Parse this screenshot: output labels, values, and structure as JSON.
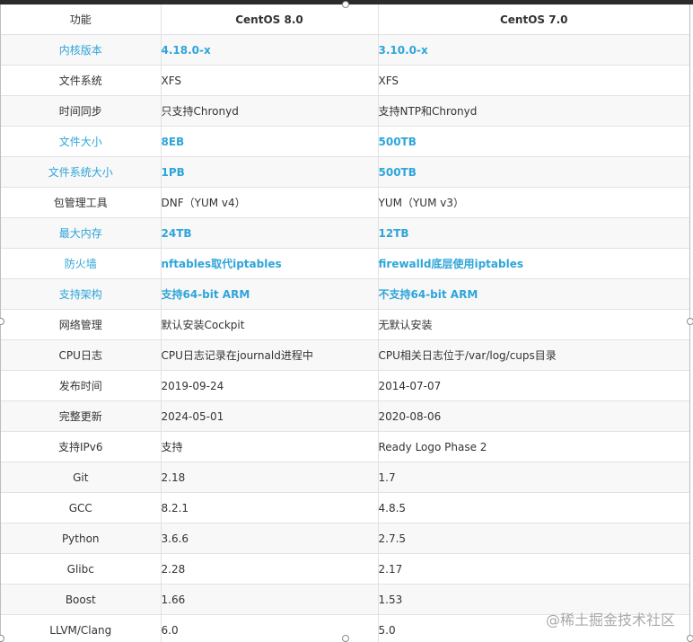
{
  "table": {
    "headers": [
      "功能",
      "CentOS 8.0",
      "CentOS 7.0"
    ],
    "rows": [
      {
        "feature": "内核版本",
        "centos8": "4.18.0-x",
        "centos7": "3.10.0-x",
        "highlight": true
      },
      {
        "feature": "文件系统",
        "centos8": "XFS",
        "centos7": "XFS",
        "highlight": false
      },
      {
        "feature": "时间同步",
        "centos8": "只支持Chronyd",
        "centos7": "支持NTP和Chronyd",
        "highlight": false
      },
      {
        "feature": "文件大小",
        "centos8": "8EB",
        "centos7": "500TB",
        "highlight": true
      },
      {
        "feature": "文件系统大小",
        "centos8": "1PB",
        "centos7": "500TB",
        "highlight": true
      },
      {
        "feature": "包管理工具",
        "centos8": "DNF（YUM v4）",
        "centos7": "YUM（YUM v3）",
        "highlight": false
      },
      {
        "feature": "最大内存",
        "centos8": "24TB",
        "centos7": "12TB",
        "highlight": true
      },
      {
        "feature": "防火墙",
        "centos8": "nftables取代iptables",
        "centos7": "firewalld底层使用iptables",
        "highlight": true
      },
      {
        "feature": "支持架构",
        "centos8": "支持64-bit ARM",
        "centos7": "不支持64-bit ARM",
        "highlight": true
      },
      {
        "feature": "网络管理",
        "centos8": "默认安装Cockpit",
        "centos7": "无默认安装",
        "highlight": false
      },
      {
        "feature": "CPU日志",
        "centos8": "CPU日志记录在journald进程中",
        "centos7": "CPU相关日志位于/var/log/cups目录",
        "highlight": false
      },
      {
        "feature": "发布时间",
        "centos8": "2019-09-24",
        "centos7": "2014-07-07",
        "highlight": false
      },
      {
        "feature": "完整更新",
        "centos8": "2024-05-01",
        "centos7": "2020-08-06",
        "highlight": false
      },
      {
        "feature": "支持IPv6",
        "centos8": "支持",
        "centos7": "Ready Logo Phase 2",
        "highlight": false
      },
      {
        "feature": "Git",
        "centos8": "2.18",
        "centos7": "1.7",
        "highlight": false
      },
      {
        "feature": "GCC",
        "centos8": "8.2.1",
        "centos7": "4.8.5",
        "highlight": false
      },
      {
        "feature": "Python",
        "centos8": "3.6.6",
        "centos7": "2.7.5",
        "highlight": false
      },
      {
        "feature": "Glibc",
        "centos8": "2.28",
        "centos7": "2.17",
        "highlight": false
      },
      {
        "feature": "Boost",
        "centos8": "1.66",
        "centos7": "1.53",
        "highlight": false
      },
      {
        "feature": "LLVM/Clang",
        "centos8": "6.0",
        "centos7": "5.0",
        "highlight": false
      }
    ]
  },
  "watermark": "@稀土掘金技术社区"
}
